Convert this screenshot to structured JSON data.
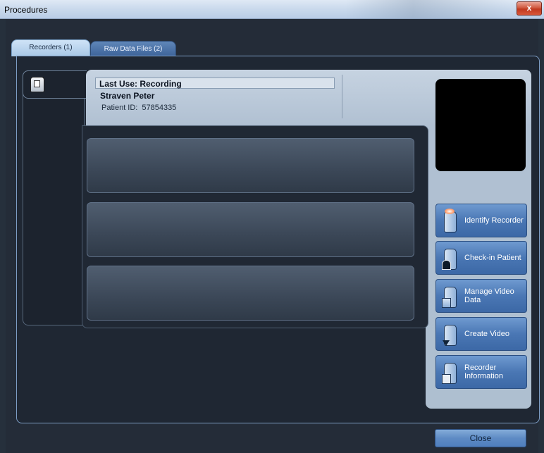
{
  "window": {
    "title": "Procedures",
    "close_glyph": "x"
  },
  "tabs": [
    {
      "label": "Recorders (1)",
      "active": true
    },
    {
      "label": "Raw Data Files (2)",
      "active": false
    }
  ],
  "device": {
    "icon": "recorder-icon"
  },
  "recorder_info": {
    "last_use": "Last Use: Recording",
    "patient_name": "Straven Peter",
    "patient_id_label": "Patient ID:",
    "patient_id_value": "57854335"
  },
  "actions": [
    {
      "label": "Identify Recorder",
      "icon": "identify-recorder-icon"
    },
    {
      "label": "Check-in Patient",
      "icon": "check-in-patient-icon"
    },
    {
      "label": "Manage Video Data",
      "icon": "manage-video-data-icon"
    },
    {
      "label": "Create Video",
      "icon": "create-video-icon"
    },
    {
      "label": "Recorder Information",
      "icon": "recorder-information-icon"
    }
  ],
  "footer": {
    "close_label": "Close"
  },
  "colors": {
    "background": "#242c38",
    "panel": "#b0c0d2",
    "accent": "#4a77b4"
  }
}
